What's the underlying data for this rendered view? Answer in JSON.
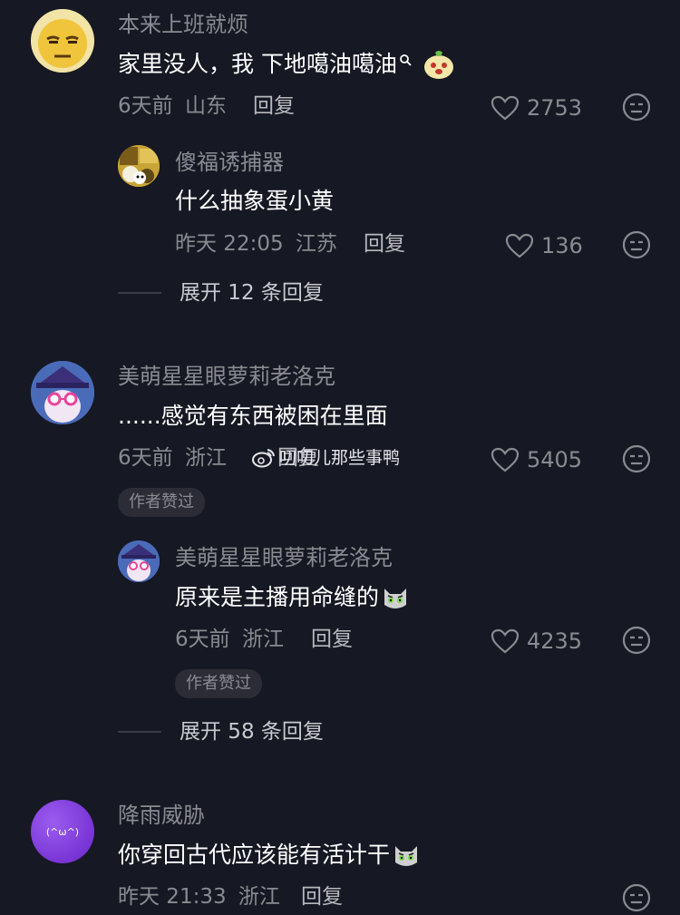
{
  "watermark": {
    "text": "叨叨儿那些事鸭",
    "icon": "weibo-icon"
  },
  "comments": [
    {
      "username": "本来上班就烦",
      "text": "家里没人，我 下地噶油噶油",
      "time": "6天前",
      "location": "山东",
      "reply_label": "回复",
      "likes": "2753",
      "avatar_icon": "annoyed-face-avatar",
      "trailing_icons": [
        "search-icon",
        "pear-cat-emoji"
      ],
      "replies": [
        {
          "username": "傻福诱捕器",
          "text": "什么抽象蛋小黄",
          "time": "昨天 22:05",
          "location": "江苏",
          "reply_label": "回复",
          "likes": "136"
        }
      ],
      "expand_label": "展开 12 条回复"
    },
    {
      "username": "美萌星星眼萝莉老洛克",
      "text": "......感觉有东西被困在里面",
      "time": "6天前",
      "location": "浙江",
      "reply_label": "回复",
      "likes": "5405",
      "badge": "作者赞过",
      "replies": [
        {
          "username": "美萌星星眼萝莉老洛克",
          "text": "原来是主播用命缝的",
          "time": "6天前",
          "location": "浙江",
          "reply_label": "回复",
          "likes": "4235",
          "badge": "作者赞过",
          "trailing_icons": [
            "cat-emoji"
          ]
        }
      ],
      "expand_label": "展开 58 条回复"
    },
    {
      "username": "降雨威胁",
      "text": "你穿回古代应该能有活计干",
      "time": "昨天 21:33",
      "location": "浙江",
      "reply_label": "回复",
      "avatar_text": "(^ω^)",
      "trailing_icons": [
        "cat-emoji"
      ]
    }
  ],
  "colors": {
    "background": "#161823",
    "muted": "#8a8b91",
    "text": "#ffffff",
    "avatar_purple": "#7b35d6"
  }
}
